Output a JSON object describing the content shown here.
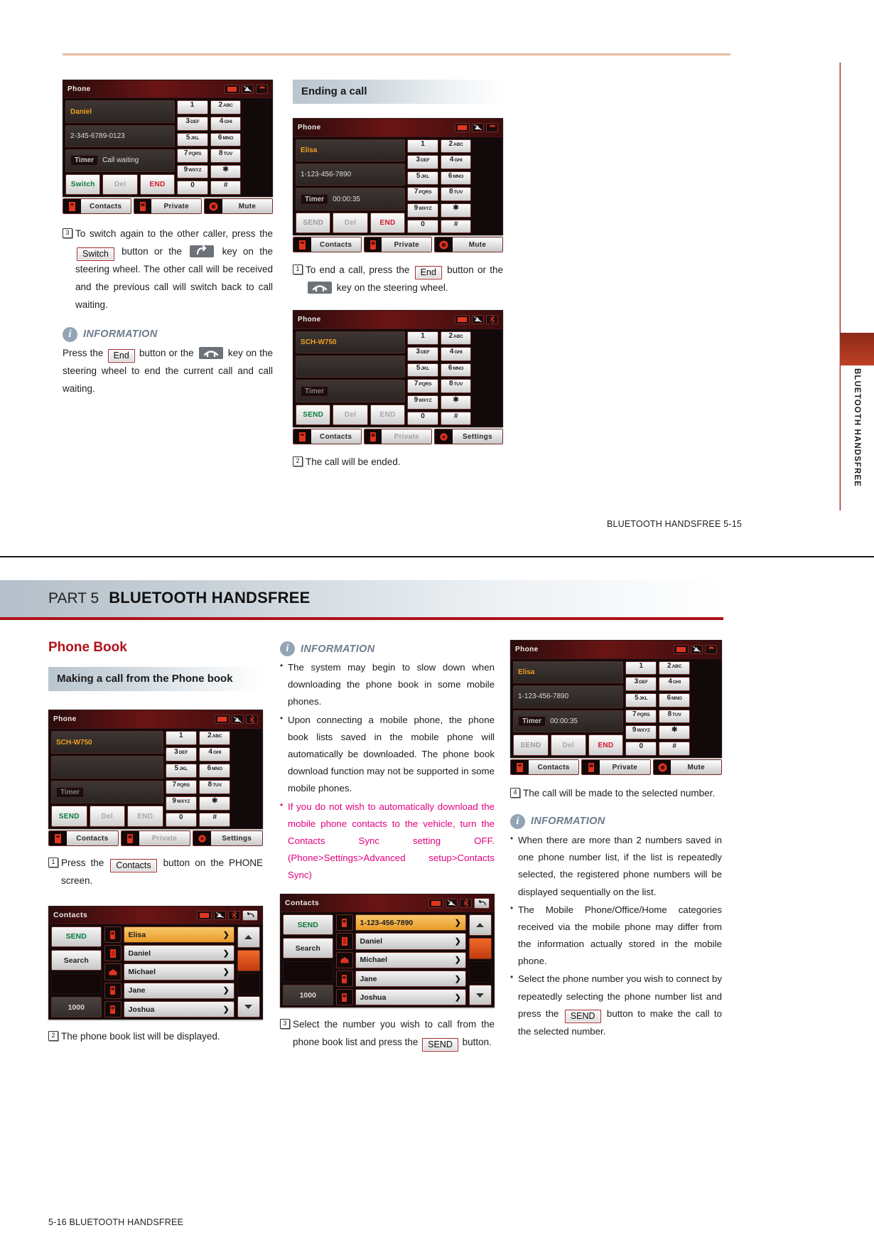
{
  "page1": {
    "footer": "BLUETOOTH HANDSFREE   5-15",
    "side_tab_label": "BLUETOOTH HANDSFREE",
    "screen_switch": {
      "title": "Phone",
      "status_icons": [
        "battery-icon",
        "signal-icon",
        "call-icon"
      ],
      "name": "Daniel",
      "number": "2-345-6789-0123",
      "timer_label": "Timer",
      "timer_value": "Call waiting",
      "soft_keys": [
        "Switch",
        "Del",
        "END"
      ],
      "keypad": [
        {
          "d": "1",
          "s": ""
        },
        {
          "d": "2",
          "s": "ABC"
        },
        {
          "d": "3",
          "s": "DEF"
        },
        {
          "d": "4",
          "s": "GHI"
        },
        {
          "d": "5",
          "s": "JKL"
        },
        {
          "d": "6",
          "s": "MNO"
        },
        {
          "d": "7",
          "s": "PQRS"
        },
        {
          "d": "8",
          "s": "TUV"
        },
        {
          "d": "9",
          "s": "WXYZ"
        },
        {
          "d": "✱",
          "s": ""
        },
        {
          "d": "0",
          "s": ""
        },
        {
          "d": "#",
          "s": ""
        }
      ],
      "bottom": [
        {
          "label": "Contacts",
          "icon": "handset-icon"
        },
        {
          "label": "Private",
          "icon": "mobile-icon"
        },
        {
          "label": "Mute",
          "icon": "mute-icon"
        }
      ]
    },
    "step3": {
      "num": "3",
      "t1": "To switch again to the other caller, press the ",
      "b1": "Switch",
      "t2": " button or the ",
      "k1": "call-answer-key",
      "t3": " key on the steering wheel. The other call will be received and the previous call will switch back to call waiting."
    },
    "info1": {
      "title": "INFORMATION",
      "t1": "Press the ",
      "b1": "End",
      "t2": " button or the ",
      "k1": "call-end-key",
      "t3": " key on the steering wheel to end the current call and call waiting."
    },
    "ending_head": "Ending a call",
    "screen_end": {
      "title": "Phone",
      "status_icons": [
        "battery-icon",
        "signal-icon",
        "call-icon"
      ],
      "name": "Elisa",
      "number": "1-123-456-7890",
      "timer_label": "Timer",
      "timer_value": "00:00:35",
      "soft_keys": [
        "SEND",
        "Del",
        "END"
      ],
      "bottom": [
        {
          "label": "Contacts",
          "icon": "handset-icon"
        },
        {
          "label": "Private",
          "icon": "mobile-icon"
        },
        {
          "label": "Mute",
          "icon": "mute-icon"
        }
      ]
    },
    "step1": {
      "num": "1",
      "t1": "To end a call, press the ",
      "b1": "End",
      "t2": " button or the ",
      "k1": "call-end-key",
      "t3": " key on the steering wheel."
    },
    "screen_ended": {
      "title": "Phone",
      "status_icons": [
        "battery-icon",
        "signal-icon",
        "bluetooth-icon"
      ],
      "name": "SCH-W750",
      "number": "",
      "timer_label": "Timer",
      "timer_value": "",
      "soft_keys": [
        "SEND",
        "Del",
        "END"
      ],
      "bottom": [
        {
          "label": "Contacts",
          "icon": "handset-icon"
        },
        {
          "label": "Private",
          "icon": "mobile-icon"
        },
        {
          "label": "Settings",
          "icon": "gear-icon"
        }
      ]
    },
    "step2": {
      "num": "2",
      "text": "The call will be ended."
    }
  },
  "page2": {
    "part_label": "PART 5",
    "part_title": "BLUETOOTH HANDSFREE",
    "footer": "5-16   BLUETOOTH HANDSFREE",
    "section_title": "Phone Book",
    "sub_head": "Making a call from the Phone book",
    "screen_phone": {
      "title": "Phone",
      "status_icons": [
        "battery-icon",
        "signal-icon",
        "bluetooth-icon"
      ],
      "name": "SCH-W750",
      "number": "",
      "timer_label": "Timer",
      "timer_value": "",
      "soft_keys": [
        "SEND",
        "Del",
        "END"
      ],
      "bottom": [
        {
          "label": "Contacts",
          "icon": "handset-icon"
        },
        {
          "label": "Private",
          "icon": "mobile-icon"
        },
        {
          "label": "Settings",
          "icon": "gear-icon"
        }
      ]
    },
    "step1": {
      "num": "1",
      "t1": "Press the ",
      "b1": "Contacts",
      "t2": " button on the PHONE screen."
    },
    "contacts1": {
      "title": "Contacts",
      "status_icons": [
        "battery-icon",
        "signal-icon",
        "bluetooth-icon"
      ],
      "left_buttons": [
        "SEND",
        "Search",
        "1000"
      ],
      "rows": [
        {
          "label": "Elisa",
          "icon": "mobile-icon",
          "selected": true
        },
        {
          "label": "Daniel",
          "icon": "office-icon",
          "selected": false
        },
        {
          "label": "Michael",
          "icon": "home-icon",
          "selected": false
        },
        {
          "label": "Jane",
          "icon": "mobile-icon",
          "selected": false
        },
        {
          "label": "Joshua",
          "icon": "mobile-icon",
          "selected": false
        }
      ],
      "side_buttons": [
        "back-icon",
        "up-icon",
        "scroll-thumb",
        "down-icon"
      ]
    },
    "step2": {
      "num": "2",
      "text": "The phone book list will be displayed."
    },
    "info_left": {
      "title": "INFORMATION",
      "items": [
        {
          "text": "The system may begin to slow down when downloading the phone book in some mobile phones.",
          "magenta": false
        },
        {
          "text": "Upon connecting a mobile phone, the phone book lists saved in the mobile phone will automatically be downloaded. The phone book download function may not be supported in some mobile phones.",
          "magenta": false
        },
        {
          "text": "If you do not wish to automatically download the mobile phone contacts to the vehicle, turn the Contacts Sync setting OFF. (Phone>Settings>Advanced setup>Contacts Sync)",
          "magenta": true
        }
      ]
    },
    "contacts2": {
      "title": "Contacts",
      "status_icons": [
        "battery-icon",
        "signal-icon",
        "bluetooth-icon"
      ],
      "left_buttons": [
        "SEND",
        "Search",
        "1000"
      ],
      "rows": [
        {
          "label": "1-123-456-7890",
          "icon": "mobile-icon",
          "selected": true
        },
        {
          "label": "Daniel",
          "icon": "office-icon",
          "selected": false
        },
        {
          "label": "Michael",
          "icon": "home-icon",
          "selected": false
        },
        {
          "label": "Jane",
          "icon": "mobile-icon",
          "selected": false
        },
        {
          "label": "Joshua",
          "icon": "mobile-icon",
          "selected": false
        }
      ],
      "side_buttons": [
        "back-icon",
        "up-icon",
        "scroll-thumb",
        "down-icon"
      ]
    },
    "step3": {
      "num": "3",
      "t1": "Select the number you wish to call from the phone book list and press the ",
      "b1": "SEND",
      "t2": " button."
    },
    "screen_call": {
      "title": "Phone",
      "status_icons": [
        "battery-icon",
        "signal-icon",
        "call-icon"
      ],
      "name": "Elisa",
      "number": "1-123-456-7890",
      "timer_label": "Timer",
      "timer_value": "00:00:35",
      "soft_keys": [
        "SEND",
        "Del",
        "END"
      ],
      "bottom": [
        {
          "label": "Contacts",
          "icon": "handset-icon"
        },
        {
          "label": "Private",
          "icon": "mobile-icon"
        },
        {
          "label": "Mute",
          "icon": "mute-icon"
        }
      ]
    },
    "step4": {
      "num": "4",
      "text": "The call will be made to the selected number."
    },
    "info_right": {
      "title": "INFORMATION",
      "items": [
        {
          "t1": "When there are more than 2 numbers saved in one phone number list, if the list is repeatedly selected, the registered phone numbers will be displayed sequentially on the list.",
          "b": "",
          "t2": ""
        },
        {
          "t1": "The Mobile Phone/Office/Home categories received via the mobile phone may differ from the information actually stored in the mobile phone.",
          "b": "",
          "t2": ""
        },
        {
          "t1": "Select the phone number you wish to connect by repeatedly selecting the phone number list and press the ",
          "b": "SEND",
          "t2": " button to make the call to the selected number."
        }
      ]
    }
  },
  "colors": {
    "accent_red": "#b01119",
    "magenta": "#e3007f",
    "info_gray": "#6e7d8c",
    "top_rule": "#e9bda0"
  }
}
